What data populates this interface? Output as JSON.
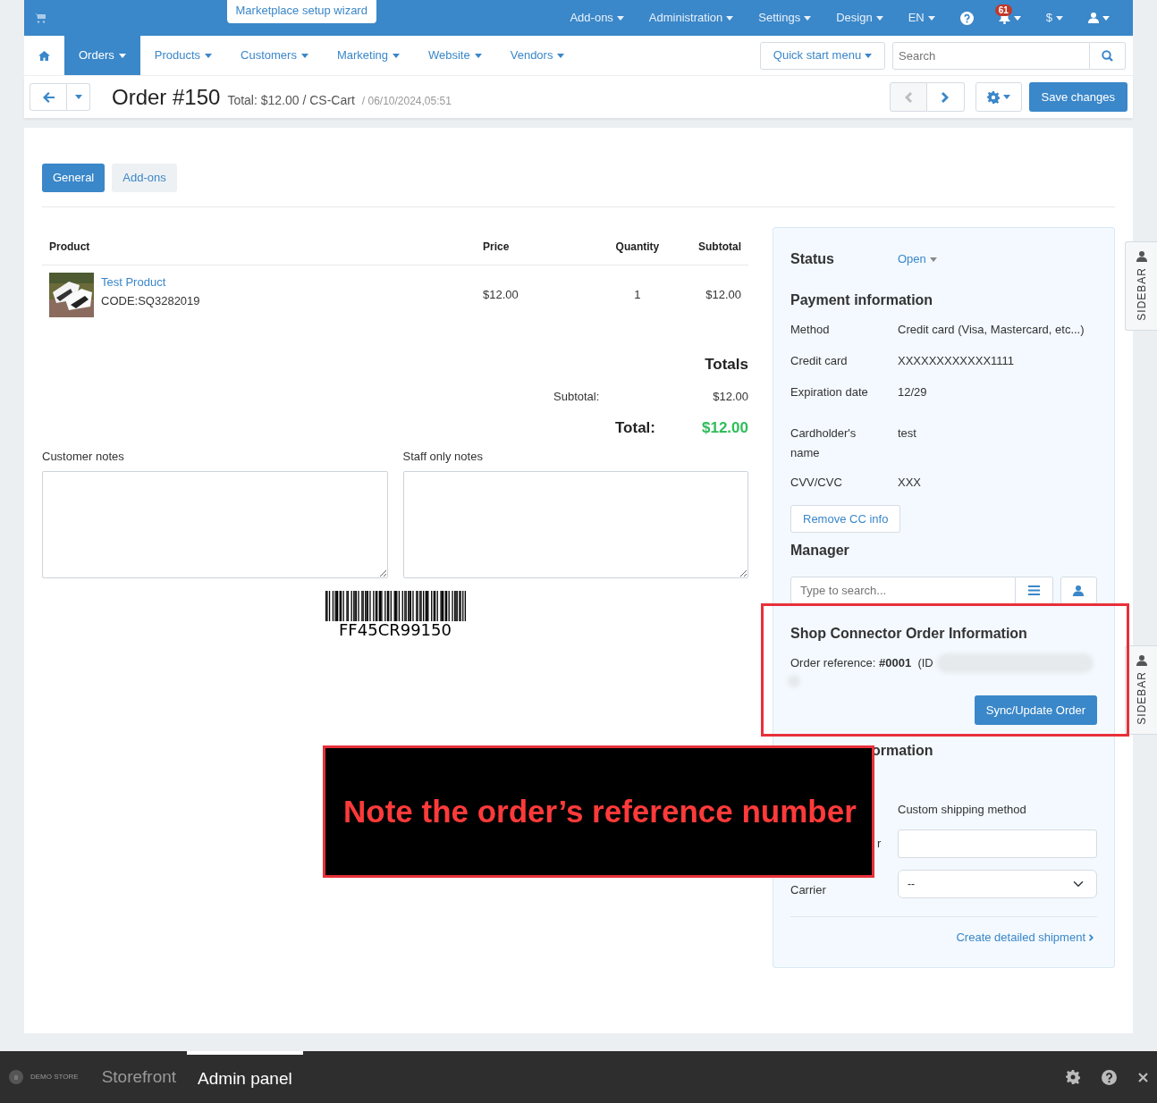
{
  "top_bar": {
    "wizard_button": "Marketplace setup wizard",
    "menus": [
      {
        "label": "Add-ons"
      },
      {
        "label": "Administration"
      },
      {
        "label": "Settings"
      },
      {
        "label": "Design"
      },
      {
        "label": "EN"
      }
    ],
    "notifications_count": "61",
    "currency": "$"
  },
  "main_nav": {
    "items": [
      {
        "label": "Orders",
        "selected": true
      },
      {
        "label": "Products",
        "selected": false
      },
      {
        "label": "Customers",
        "selected": false
      },
      {
        "label": "Marketing",
        "selected": false
      },
      {
        "label": "Website",
        "selected": false
      },
      {
        "label": "Vendors",
        "selected": false
      }
    ],
    "quick_start": "Quick start menu",
    "search": {
      "placeholder": "Search"
    }
  },
  "page_header": {
    "title": "Order #150",
    "subtitle": "Total: $12.00 / CS-Cart",
    "date": "/ 06/10/2024,05:51",
    "prev_disabled": true,
    "save_button": "Save changes"
  },
  "tabs": [
    {
      "label": "General",
      "selected": true
    },
    {
      "label": "Add-ons",
      "selected": false
    }
  ],
  "products_table": {
    "columns": [
      "Product",
      "Price",
      "Quantity",
      "Subtotal"
    ],
    "rows": [
      {
        "name": "Test Product",
        "code": "CODE:SQ3282019",
        "price": "$12.00",
        "quantity": "1",
        "subtotal": "$12.00"
      }
    ]
  },
  "totals": {
    "title": "Totals",
    "subtotal_label": "Subtotal:",
    "subtotal": "$12.00",
    "total_label": "Total:",
    "total": "$12.00"
  },
  "notes": [
    {
      "label": "Customer notes"
    },
    {
      "label": "Staff only notes"
    }
  ],
  "barcode": {
    "text": "FF45CR99150"
  },
  "side_panel": {
    "status_label": "Status",
    "status": "Open",
    "payment_title": "Payment information",
    "payment_rows": [
      {
        "label": "Method",
        "value": "Credit card (Visa, Mastercard, etc...)"
      },
      {
        "label": "Credit card",
        "value": "XXXXXXXXXXXX1111"
      },
      {
        "label": "Expiration date",
        "value": "12/29"
      },
      {
        "label": "Cardholder's name",
        "value": "test"
      },
      {
        "label": "CVV/CVC",
        "value": "XXX"
      }
    ],
    "remove_button": "Remove CC info",
    "manager_title": "Manager",
    "manager_search": {
      "placeholder": "Type to search..."
    },
    "shop_connector": {
      "title": "Shop Connector Order Information",
      "reference": "Order reference: **#0001**  (ID",
      "sync_button": "Sync/Update Order"
    },
    "shipping_title_fragment": "ormation",
    "shipping_method": "Custom shipping method",
    "tracking_fragment": "r",
    "carrier_label": "Carrier",
    "carrier_value": "--",
    "shipment_link": "Create detailed shipment"
  },
  "sidebar_tabs": [
    "SIDEBAR",
    "SIDEBAR"
  ],
  "annotation": {
    "text": "Note the order’s reference number"
  },
  "bottom_bar": {
    "brand": "DEMO STORE",
    "modes": [
      {
        "label": "Storefront",
        "selected": false
      },
      {
        "label": "Admin panel",
        "selected": true
      }
    ]
  }
}
